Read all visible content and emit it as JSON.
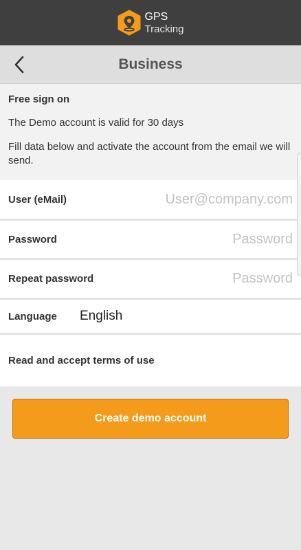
{
  "app": {
    "logo_line1": "GPS",
    "logo_line2": "Tracking"
  },
  "header": {
    "title": "Business",
    "back_icon": "chevron-left-icon"
  },
  "intro": {
    "heading": "Free sign on",
    "validity": "The Demo account is valid for 30 days",
    "instructions": "Fill data below and activate the account from the email we will send."
  },
  "form": {
    "user": {
      "label": "User (eMail)",
      "placeholder": "User@company.com",
      "value": ""
    },
    "password": {
      "label": "Password",
      "placeholder": "Password",
      "value": ""
    },
    "repeat_password": {
      "label": "Repeat password",
      "placeholder": "Password",
      "value": ""
    },
    "language": {
      "label": "Language",
      "value": "English"
    },
    "terms": {
      "label": "Read and accept terms of use"
    }
  },
  "actions": {
    "create_label": "Create demo account"
  },
  "colors": {
    "topbar": "#3f3f3f",
    "accent": "#f49b1c",
    "header_bg": "#dedede",
    "page_bg": "#e8e8e8"
  }
}
